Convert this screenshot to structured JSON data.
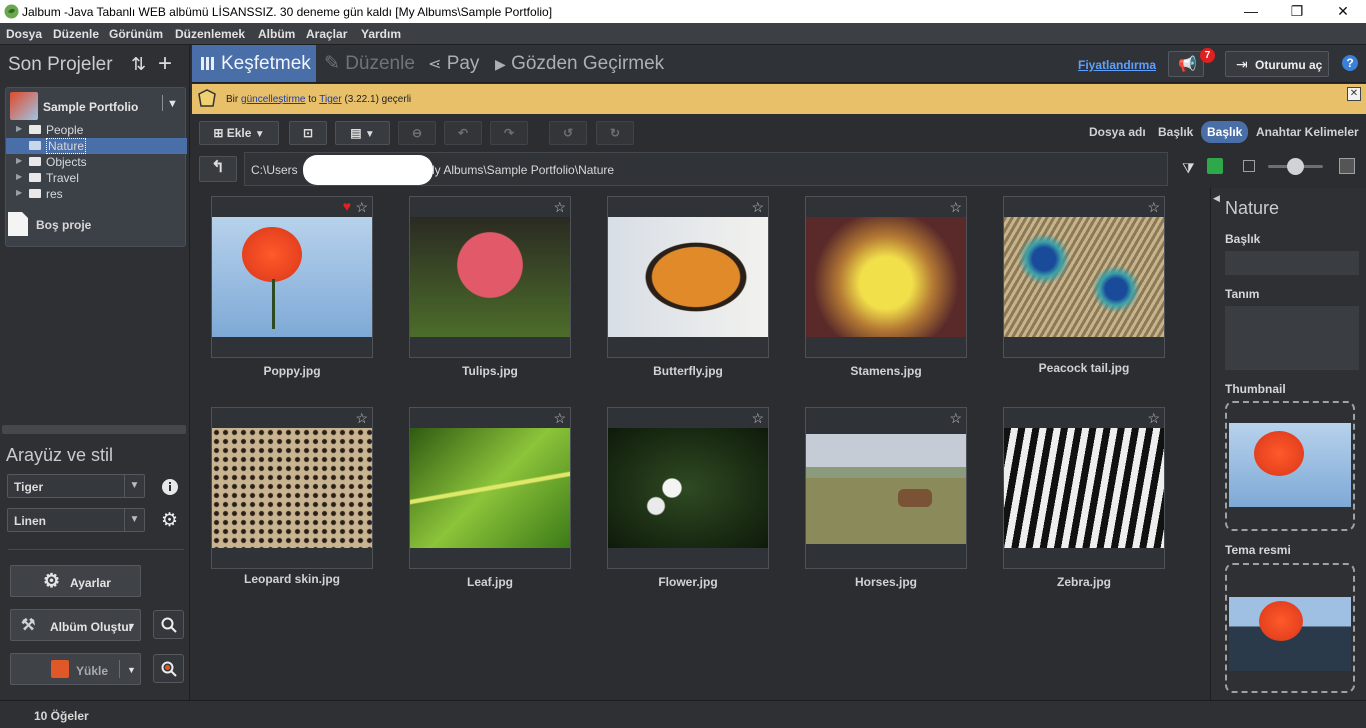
{
  "window": {
    "title": "Jalbum -Java Tabanlı WEB albümü LİSANSSIZ. 30 deneme gün kaldı [My Albums\\Sample Portfolio]",
    "minimize": "—",
    "maximize": "❐",
    "close": "✕"
  },
  "menu": [
    "Dosya",
    "Düzenle",
    "Görünüm",
    "Düzenlemek",
    "Albüm",
    "Araçlar",
    "Yardım"
  ],
  "left": {
    "recent_heading": "Son Projeler",
    "sort_icon": "⇅",
    "add_icon": "+",
    "project_name": "Sample Portfolio",
    "tree": [
      {
        "label": "People",
        "selected": false
      },
      {
        "label": "Nature",
        "selected": true
      },
      {
        "label": "Objects",
        "selected": false
      },
      {
        "label": "Travel",
        "selected": false
      },
      {
        "label": "res",
        "selected": false
      }
    ],
    "empty_project": "Boş proje",
    "style_heading": "Arayüz ve stil",
    "skin": "Tiger",
    "style": "Linen",
    "settings_button": "Ayarlar",
    "make_album_button": "Albüm Oluştur",
    "upload_button": "Yükle"
  },
  "tabs": {
    "explore": "Keşfetmek",
    "edit": "Düzenle",
    "share": "Pay",
    "review": "Gözden Geçirmek",
    "pricing": "Fiyatlandırma",
    "notification_count": "7",
    "login": "Oturumu aç",
    "help": "?"
  },
  "notice": {
    "prefix": "Bir",
    "link": "güncelleştirme",
    "to": "to",
    "skin_link": "Tiger",
    "suffix": "(3.22.1) geçerli",
    "close": "✕"
  },
  "toolbar": {
    "add_label": "Ekle",
    "sort_options": [
      "Dosya adı",
      "Başlık",
      "Başlık",
      "Anahtar Kelimeler"
    ],
    "active_sort_index": 2
  },
  "path": {
    "prefix": "C:\\Users",
    "suffix": "ly Albums\\Sample Portfolio\\Nature"
  },
  "images": [
    {
      "name": "Poppy.jpg",
      "fav": true
    },
    {
      "name": "Tulips.jpg",
      "fav": false
    },
    {
      "name": "Butterfly.jpg",
      "fav": false
    },
    {
      "name": "Stamens.jpg",
      "fav": false
    },
    {
      "name": "Peacock tail.jpg",
      "fav": false
    },
    {
      "name": "Leopard skin.jpg",
      "fav": false
    },
    {
      "name": "Leaf.jpg",
      "fav": false
    },
    {
      "name": "Flower.jpg",
      "fav": false
    },
    {
      "name": "Horses.jpg",
      "fav": false
    },
    {
      "name": "Zebra.jpg",
      "fav": false
    }
  ],
  "right": {
    "folder_title": "Nature",
    "title_label": "Başlık",
    "description_label": "Tanım",
    "thumbnail_label": "Thumbnail",
    "theme_label": "Tema resmi"
  },
  "status": {
    "count": "10 Öğeler"
  },
  "colors": {
    "accent": "#4a6ea8",
    "notice_bg": "#e8c06a",
    "panel_bg": "#2e3033",
    "fav_heart": "#e02222"
  }
}
